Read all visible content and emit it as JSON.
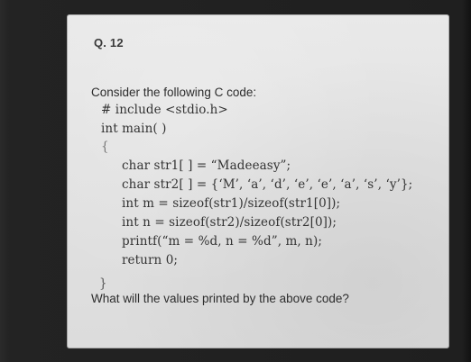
{
  "question": {
    "number": "Q. 12",
    "intro": "Consider the following C code:",
    "code_lines": [
      "# include <stdio.h>",
      "int main( )",
      "{",
      "char str1[ ] = “Madeeasy”;",
      "char str2[ ] = {‘M’, ‘a’, ‘d’, ‘e’, ‘e’, ‘a’, ‘s’, ‘y’};",
      "int m = sizeof(str1)/sizeof(str1[0]);",
      "int n = sizeof(str2)/sizeof(str2[0]);",
      "printf(“m = %d, n = %d”, m, n);",
      "return 0;",
      "}"
    ],
    "prompt": "What will the values printed by the above code?"
  }
}
